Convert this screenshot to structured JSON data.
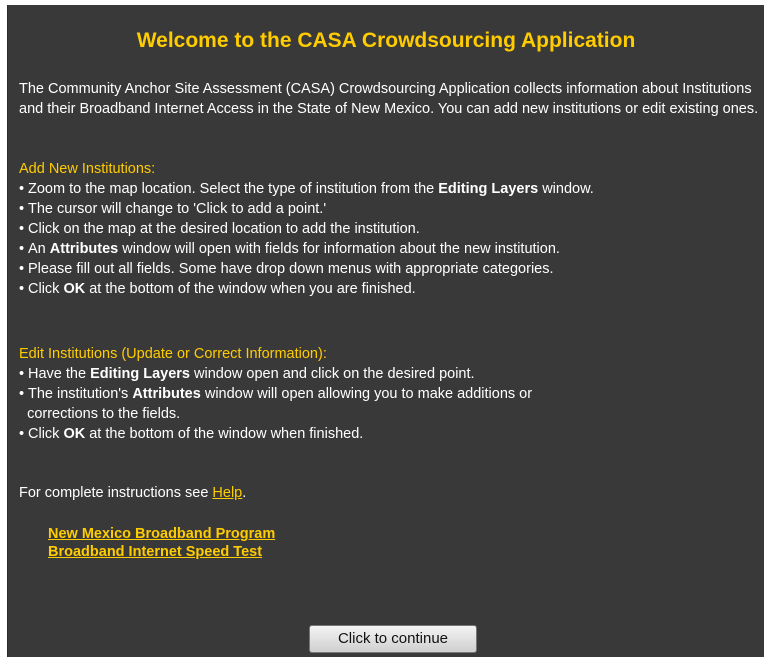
{
  "dialog": {
    "title": "Welcome to the CASA Crowdsourcing Application",
    "intro": "The Community Anchor Site Assessment (CASA) Crowdsourcing Application collects information about Institutions and their Broadband Internet Access in the State of New Mexico. You can add new institutions or edit existing ones."
  },
  "add_section": {
    "heading": "Add New Institutions:",
    "bullets": [
      {
        "pre": "Zoom to the map location. Select the type of institution from the ",
        "bold": "Editing Layers",
        "post": " window."
      },
      {
        "pre": "The cursor will change to 'Click to add a point.'",
        "bold": "",
        "post": ""
      },
      {
        "pre": "Click on the map at the desired location to add the institution.",
        "bold": "",
        "post": ""
      },
      {
        "pre": "An ",
        "bold": "Attributes",
        "post": " window will open with fields for information about the new institution."
      },
      {
        "pre": "Please fill out all fields. Some have drop down menus with appropriate categories.",
        "bold": "",
        "post": ""
      },
      {
        "pre": "Click ",
        "bold": "OK",
        "post": " at the bottom of the window when you are finished."
      }
    ]
  },
  "edit_section": {
    "heading": "Edit Institutions (Update or Correct Information):",
    "bullets": [
      {
        "pre": "Have the ",
        "bold": "Editing Layers",
        "post": " window open and click on the desired point."
      },
      {
        "pre": "The institution's ",
        "bold": "Attributes",
        "post": " window will open allowing you to make additions or\n  corrections to the fields."
      },
      {
        "pre": "Click ",
        "bold": "OK",
        "post": " at the bottom of the window when finished."
      }
    ]
  },
  "help": {
    "text": "For complete instructions see ",
    "link_label": "Help",
    "suffix": "."
  },
  "links": {
    "nm_broadband": "New Mexico Broadband Program",
    "speed_test": "Broadband Internet Speed Test"
  },
  "continue_button": {
    "label": "Click to continue"
  },
  "colors": {
    "panel_bg": "#393939",
    "accent": "#ffcc00",
    "text": "#ffffff"
  }
}
